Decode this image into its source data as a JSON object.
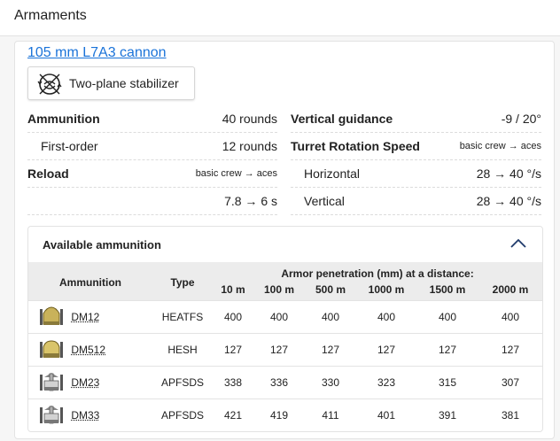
{
  "header": {
    "title": "Armaments"
  },
  "weapon": {
    "name": "105 mm L7A3 cannon"
  },
  "stabilizer": {
    "label": "Two-plane stabilizer",
    "icon": "stabilizer-icon"
  },
  "stats": {
    "ammunition": {
      "label": "Ammunition",
      "value": "40 rounds"
    },
    "first_order": {
      "label": "First-order",
      "value": "12 rounds"
    },
    "reload": {
      "label": "Reload",
      "note": "basic crew → aces",
      "value": "7.8 → 6 s"
    },
    "vertical_guidance": {
      "label": "Vertical guidance",
      "value": "-9 / 20°"
    },
    "turret_rotation": {
      "label": "Turret Rotation Speed",
      "note": "basic crew → aces"
    },
    "horizontal": {
      "label": "Horizontal",
      "value": "28 → 40 °/s"
    },
    "vertical": {
      "label": "Vertical",
      "value": "28 → 40 °/s"
    }
  },
  "ammo": {
    "title": "Available ammunition",
    "headers": {
      "ammunition": "Ammunition",
      "type": "Type",
      "penetration": "Armor penetration (mm) at a distance:",
      "distances": [
        "10 m",
        "100 m",
        "500 m",
        "1000 m",
        "1500 m",
        "2000 m"
      ]
    },
    "rows": [
      {
        "name": "DM12",
        "type": "HEATFS",
        "values": [
          "400",
          "400",
          "400",
          "400",
          "400",
          "400"
        ]
      },
      {
        "name": "DM512",
        "type": "HESH",
        "values": [
          "127",
          "127",
          "127",
          "127",
          "127",
          "127"
        ]
      },
      {
        "name": "DM23",
        "type": "APFSDS",
        "values": [
          "338",
          "336",
          "330",
          "323",
          "315",
          "307"
        ]
      },
      {
        "name": "DM33",
        "type": "APFSDS",
        "values": [
          "421",
          "419",
          "411",
          "401",
          "391",
          "381"
        ]
      }
    ],
    "colors": {
      "shell": "#c9b25a",
      "header_bg": "#ececec"
    }
  }
}
